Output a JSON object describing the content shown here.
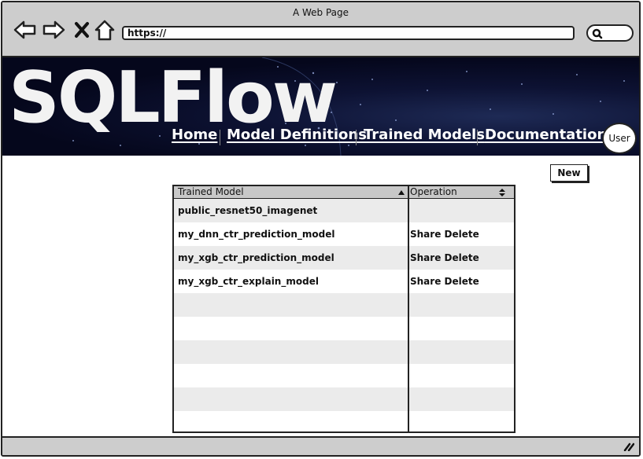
{
  "window": {
    "title": "A Web Page"
  },
  "browser": {
    "url": "https://",
    "icons": [
      "back-arrow-icon",
      "forward-arrow-icon",
      "close-x-icon",
      "home-icon",
      "search-icon"
    ]
  },
  "header": {
    "logo_text": "SQLFlow",
    "nav": [
      {
        "label": "Home"
      },
      {
        "label": "Model Definitions"
      },
      {
        "label": "Trained Models"
      },
      {
        "label": "Documentation"
      }
    ],
    "user_label": "User"
  },
  "toolbar": {
    "new_label": "New"
  },
  "table": {
    "columns": [
      "Trained Model",
      "Operation"
    ],
    "rows": [
      {
        "name": "public_resnet50_imagenet",
        "share": "",
        "delete": ""
      },
      {
        "name": "my_dnn_ctr_prediction_model",
        "share": "Share",
        "delete": "Delete"
      },
      {
        "name": "my_xgb_ctr_prediction_model",
        "share": "Share",
        "delete": "Delete"
      },
      {
        "name": "my_xgb_ctr_explain_model",
        "share": "Share",
        "delete": "Delete"
      }
    ]
  },
  "colors": {
    "chrome": "#cdcdcd",
    "banner": "#05071c",
    "row_alt": "#ebebeb",
    "header_row": "#c8c8c8"
  }
}
